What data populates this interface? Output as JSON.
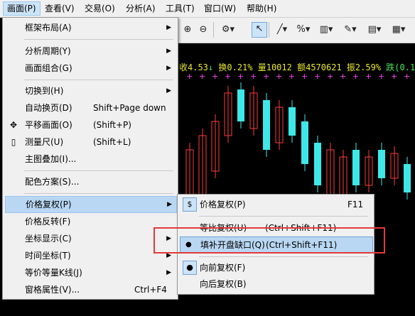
{
  "menubar": {
    "items": [
      "画面(P)",
      "查看(V)",
      "交易(O)",
      "分析(A)",
      "工具(T)",
      "窗口(W)",
      "帮助(H)"
    ]
  },
  "toolbar": {
    "icons": [
      "zoom-in-icon",
      "zoom-out-icon",
      "gear-icon",
      "cursor-icon",
      "line-tool-icon",
      "percent-icon",
      "indicator-icon",
      "draw-icon",
      "chart-type-icon"
    ]
  },
  "stat_bar": {
    "close": "收4.53",
    "arrow": "↓",
    "turnover": "换0.21%",
    "volume": "量10012",
    "amount": "额4570621",
    "amplitude": "振2.59%",
    "change": "跌(0.1"
  },
  "menu": {
    "items": [
      {
        "label": "框架布局(A)",
        "submenu": true
      },
      {
        "label": "分析周期(Y)",
        "submenu": true
      },
      {
        "label": "画面组合(G)",
        "submenu": true
      },
      {
        "label": "切换到(H)",
        "submenu": true
      },
      {
        "label": "自动换页(D)",
        "shortcut": "Shift+Page down"
      },
      {
        "label": "平移画面(O)",
        "shortcut": "(Shift+P)",
        "icon": "move-icon"
      },
      {
        "label": "测量尺(U)",
        "shortcut": "(Shift+L)",
        "icon": "ruler-icon"
      },
      {
        "label": "主图叠加(I)..."
      },
      {
        "label": "配色方案(S)..."
      },
      {
        "label": "价格复权(P)",
        "submenu": true,
        "highlighted": true
      },
      {
        "label": "价格反转(F)"
      },
      {
        "label": "坐标显示(C)",
        "submenu": true
      },
      {
        "label": "时间坐标(T)",
        "submenu": true
      },
      {
        "label": "等价等量K线(J)",
        "submenu": true
      },
      {
        "label": "窗格属性(V)...",
        "shortcut": "Ctrl+F4"
      }
    ]
  },
  "submenu": {
    "items": [
      {
        "label": "价格复权(P)",
        "shortcut": "F11",
        "icon": "dollar-icon"
      },
      {
        "label": "等比复权(U)",
        "shortcut": "(Ctrl+Shift+F11)"
      },
      {
        "label": "填补开盘缺口(Q)",
        "shortcut": "(Ctrl+Shift+F11)",
        "bullet": true,
        "highlighted": true
      },
      {
        "label": "向前复权(F)",
        "bullet": true
      },
      {
        "label": "向后复权(B)"
      }
    ]
  },
  "colors": {
    "up": "#ff3b3b",
    "down": "#3fe8e8",
    "stat_yellow": "#e8e830",
    "stat_green": "#3fe85a",
    "marker": "#ff44ff",
    "highlight_box": "#e23a3a"
  }
}
